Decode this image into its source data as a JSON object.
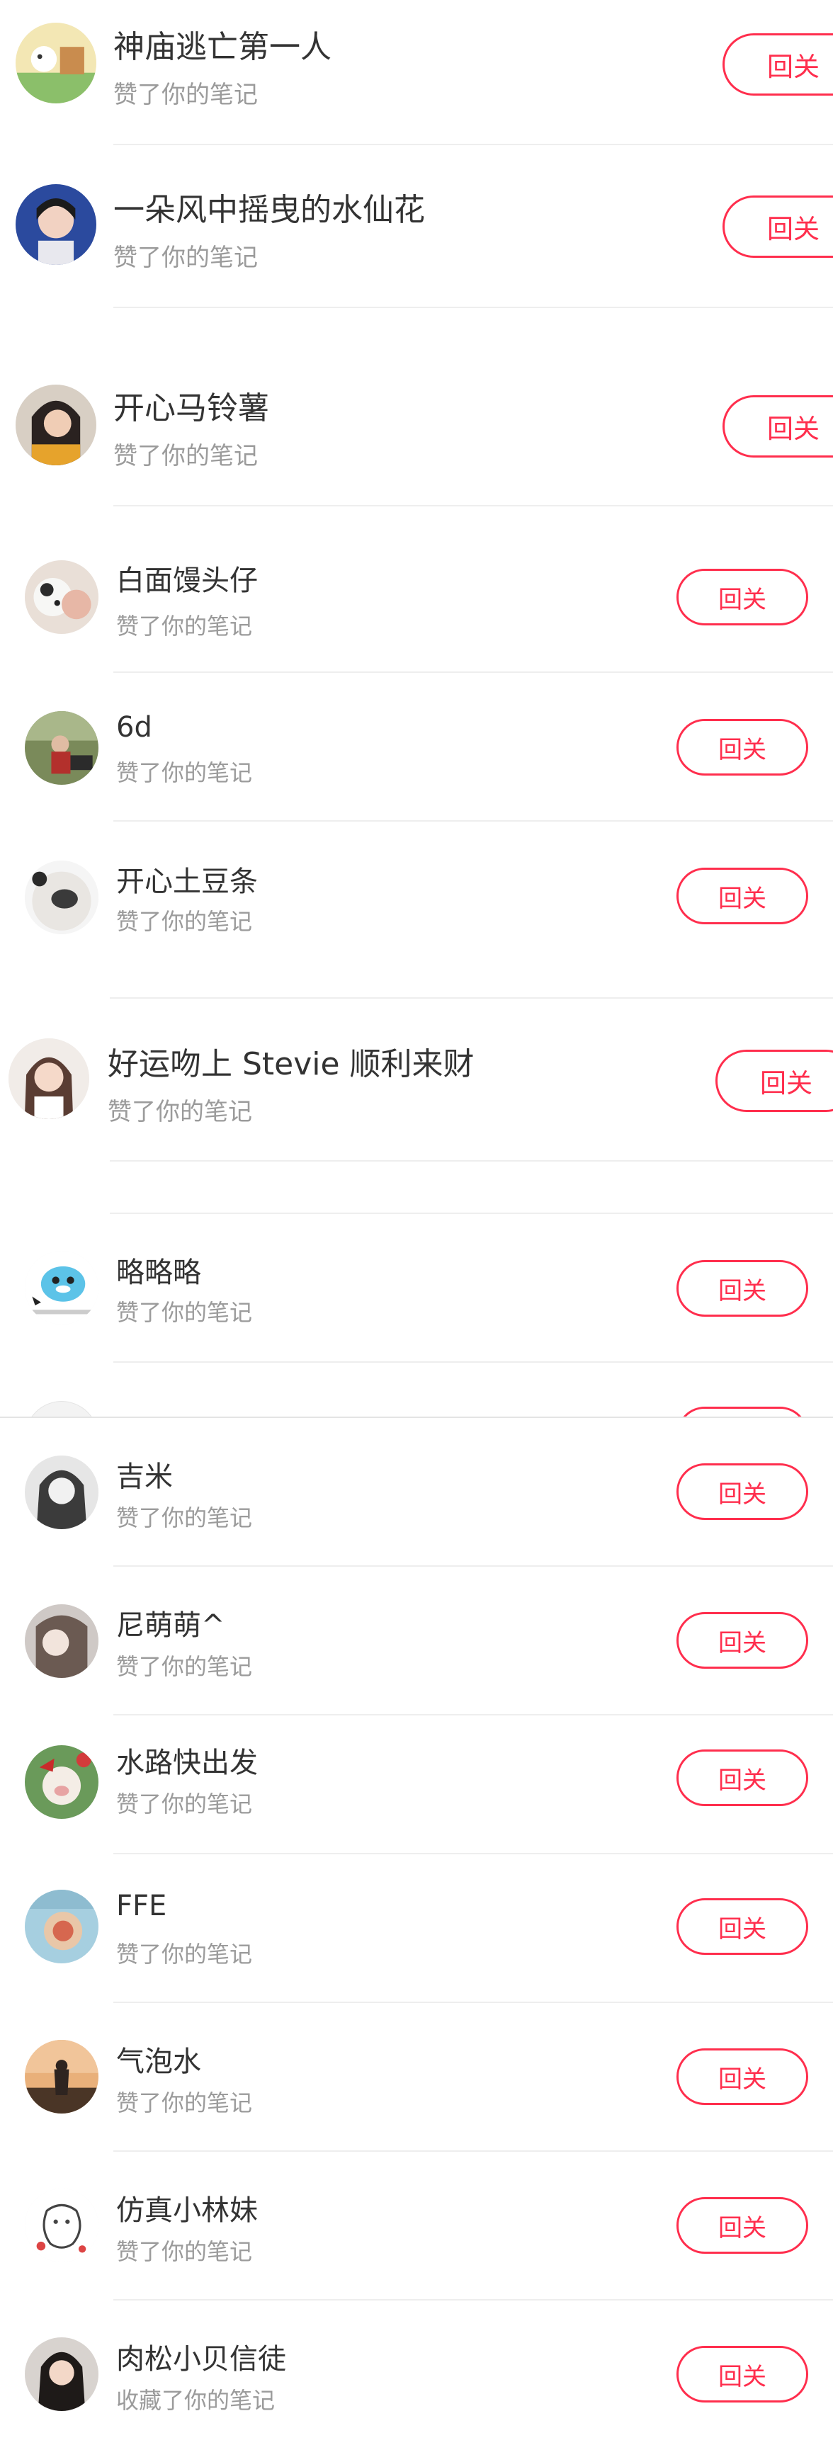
{
  "ui": {
    "accent": "#ff2e4d",
    "follow_back_label": "回关"
  },
  "items": [
    {
      "name": "神庙逃亡第一人",
      "action": "赞了你的笔记",
      "avatar": "cartoon-avatar"
    },
    {
      "name": "一朵风中摇曳的水仙花",
      "action": "赞了你的笔记",
      "avatar": "girl-photo-avatar"
    },
    {
      "name": "开心马铃薯",
      "action": "赞了你的笔记",
      "avatar": "girl-photo-avatar"
    },
    {
      "name": "白面馒头仔",
      "action": "赞了你的笔记",
      "avatar": "dog-photo-avatar"
    },
    {
      "name": "6d",
      "action": "赞了你的笔记",
      "avatar": "outdoor-photo-avatar"
    },
    {
      "name": "开心土豆条",
      "action": "赞了你的笔记",
      "avatar": "animal-nose-avatar"
    },
    {
      "name": "好运吻上 Stevie 顺利来财",
      "action": "赞了你的笔记",
      "avatar": "girl-photo-avatar"
    },
    {
      "name": "略略略",
      "action": "赞了你的笔记",
      "avatar": "cartoon-penguin-avatar"
    },
    {
      "name": "吉米",
      "action": "赞了你的笔记",
      "avatar": "portrait-photo-avatar"
    },
    {
      "name": "尼萌萌^",
      "action": "赞了你的笔记",
      "avatar": "portrait-photo-avatar"
    },
    {
      "name": "水路快出发",
      "action": "赞了你的笔记",
      "avatar": "cartoon-pig-avatar"
    },
    {
      "name": "FFE",
      "action": "赞了你的笔记",
      "avatar": "food-photo-avatar"
    },
    {
      "name": "气泡水",
      "action": "赞了你的笔记",
      "avatar": "sunset-photo-avatar"
    },
    {
      "name": "仿真小林妹",
      "action": "赞了你的笔记",
      "avatar": "doodle-avatar"
    },
    {
      "name": "肉松小贝信徒",
      "action": "收藏了你的笔记",
      "avatar": "girl-photo-avatar"
    }
  ]
}
